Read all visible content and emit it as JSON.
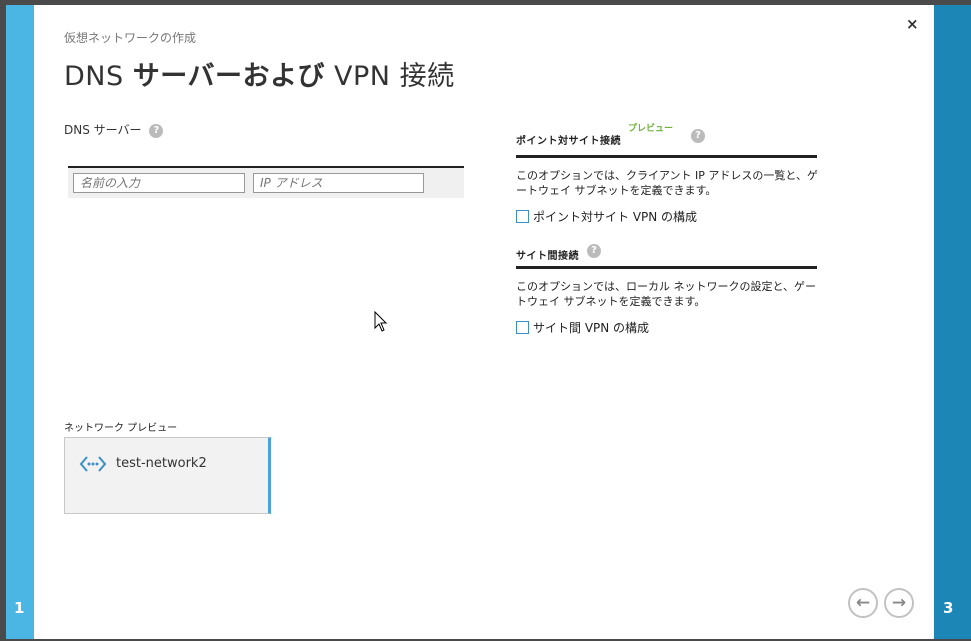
{
  "wizard": {
    "breadcrumb": "仮想ネットワークの作成",
    "title_prefix": "DNS ",
    "title_bold": "サーバーおよび",
    "title_suffix": " VPN 接続",
    "close_label": "×",
    "step_left": "1",
    "step_right": "3"
  },
  "dns": {
    "label": "DNS サーバー",
    "help_label": "?",
    "name_placeholder": "名前の入力",
    "ip_placeholder": "IP アドレス"
  },
  "point_to_site": {
    "title": "ポイント対サイト接続",
    "preview_tag": "プレビュー",
    "help_label": "?",
    "description": "このオプションでは、クライアント IP アドレスの一覧と、ゲートウェイ サブネットを定義できます。",
    "checkbox_label": "ポイント対サイト VPN の構成",
    "checked": false
  },
  "site_to_site": {
    "title": "サイト間接続",
    "help_label": "?",
    "description": "このオプションでは、ローカル ネットワークの設定と、ゲートウェイ サブネットを定義できます。",
    "checkbox_label": "サイト間 VPN の構成",
    "checked": false
  },
  "network_preview": {
    "label": "ネットワーク プレビュー",
    "network_name": "test-network2",
    "icon": "network-icon"
  },
  "nav": {
    "back_label": "←",
    "next_label": "→"
  },
  "colors": {
    "left_panel": "#4bb5e3",
    "right_panel": "#1c86b7",
    "preview_tag": "#6fb33b",
    "checkbox_border": "#3a8fc7"
  }
}
